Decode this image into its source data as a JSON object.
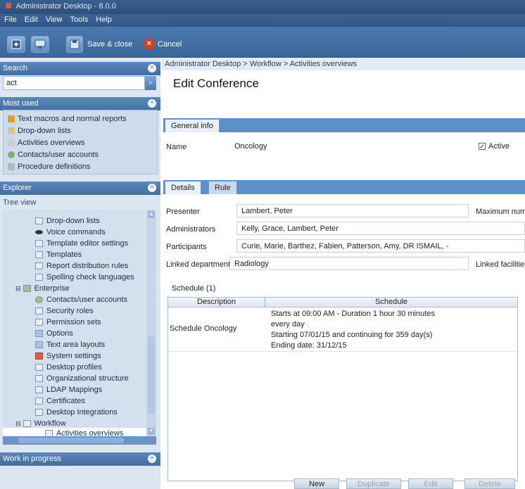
{
  "window": {
    "title": "Administrator Desktop - 8.0.0"
  },
  "menu": [
    "File",
    "Edit",
    "View",
    "Tools",
    "Help"
  ],
  "toolbar": {
    "save_close": "Save & close",
    "cancel": "Cancel"
  },
  "search": {
    "header": "Search",
    "value": "act"
  },
  "most_used": {
    "header": "Most used",
    "items": [
      "Text macros and normal reports",
      "Drop-down lists",
      "Activities overviews",
      "Contacts/user accounts",
      "Procedure definitions"
    ]
  },
  "explorer": {
    "header": "Explorer",
    "tree_view": "Tree view",
    "items": [
      "Drop-down lists",
      "Voice commands",
      "Template editor settings",
      "Templates",
      "Report distribution rules",
      "Spelling check languages",
      "Enterprise",
      "Contacts/user accounts",
      "Security roles",
      "Permission sets",
      "Options",
      "Text area layouts",
      "System settings",
      "Desktop profiles",
      "Organizational structure",
      "LDAP Mappings",
      "Certificates",
      "Desktop Integrations",
      "Workflow",
      "Activities overviews"
    ]
  },
  "work_in_progress": {
    "header": "Work in progress"
  },
  "breadcrumb": "Administrator Desktop > Workflow > Activities overviews",
  "page_title": "Edit Conference",
  "general_tab": "General info",
  "name_label": "Name",
  "name_value": "Oncology",
  "active_label": "Active",
  "detail_tabs": [
    "Details",
    "Rule"
  ],
  "details": {
    "presenter_label": "Presenter",
    "presenter_value": "Lambert, Peter",
    "max_label": "Maximum numb",
    "administrators_label": "Administrators",
    "administrators_value": "Kelly, Grace,  Lambert, Peter",
    "participants_label": "Participants",
    "participants_value": "Curie, Marie,  Barthez, Fabien,  Patterson, Amy,  DR ISMAIL, -",
    "linked_departments_label": "Linked departments",
    "linked_departments_value": "Radiology",
    "linked_facilities_label": "Linked facilities"
  },
  "schedule": {
    "label": "Schedule (1)",
    "columns": [
      "Description",
      "Schedule"
    ],
    "rows": [
      {
        "description": "Schedule Oncology",
        "lines": [
          "Starts at 09:00 AM - Duration 1 hour 30 minutes",
          "every day",
          "Starting 07/01/15 and continuing for 359 day(s)",
          "Ending date: 31/12/15"
        ]
      }
    ]
  },
  "buttons": {
    "new": "New",
    "duplicate": "Duplicate",
    "edit": "Edit",
    "delete": "Delete"
  }
}
